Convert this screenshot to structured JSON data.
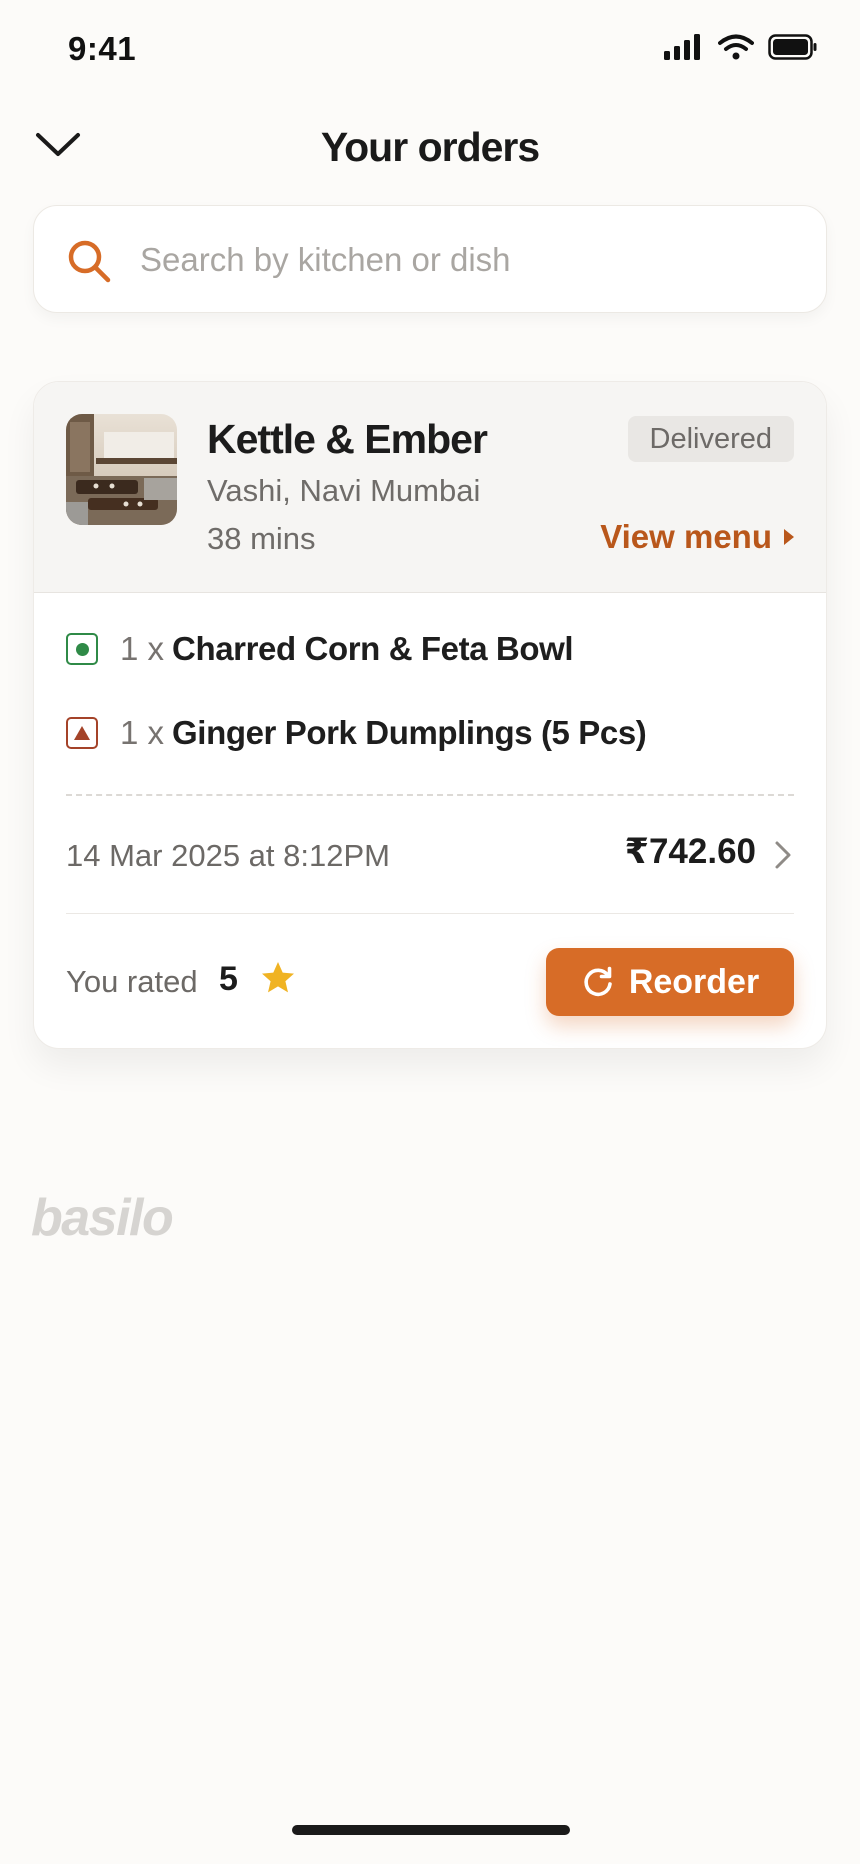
{
  "status_bar": {
    "time": "9:41",
    "icons": [
      "cellular-signal-icon",
      "wifi-icon",
      "battery-icon"
    ]
  },
  "header": {
    "title": "Your orders",
    "back_icon": "chevron-down-icon"
  },
  "search": {
    "placeholder": "Search by kitchen or dish",
    "value": "",
    "icon": "search-icon"
  },
  "order": {
    "kitchen_name": "Kettle & Ember",
    "location": "Vashi, Navi Mumbai",
    "eta": "38 mins",
    "status": "Delivered",
    "view_menu_label": "View menu",
    "items": [
      {
        "qty": "1 x",
        "name": "Charred Corn & Feta Bowl",
        "diet": "veg"
      },
      {
        "qty": "1 x",
        "name": "Ginger Pork Dumplings (5 Pcs)",
        "diet": "non-veg"
      }
    ],
    "date": "14 Mar 2025 at 8:12PM",
    "total": "₹742.60",
    "rating_label": "You rated",
    "rating_value": "5",
    "reorder_label": "Reorder"
  },
  "brand": {
    "watermark": "basilo"
  },
  "colors": {
    "accent": "#d76c27",
    "link": "#b9571b",
    "veg": "#2f8a47",
    "non_veg": "#a44329",
    "star": "#f0b323"
  }
}
